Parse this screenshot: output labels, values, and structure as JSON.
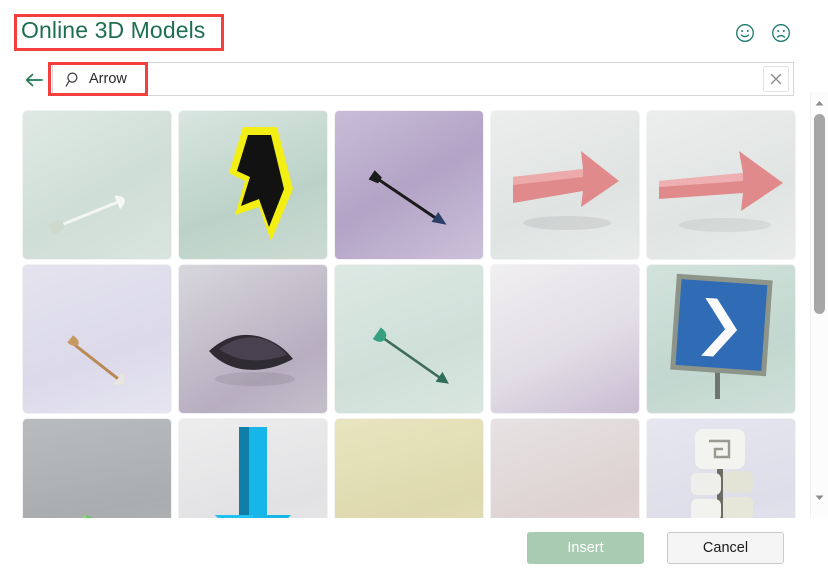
{
  "dialog": {
    "title": "Online 3D Models"
  },
  "header": {
    "feedback": [
      {
        "name": "smiley-face-icon",
        "label": "Send a smile"
      },
      {
        "name": "frowny-face-icon",
        "label": "Send a frown"
      }
    ]
  },
  "search": {
    "back_label": "Back",
    "icon": "search-icon",
    "value": "Arrow",
    "placeholder": "Search",
    "clear_label": "Clear search"
  },
  "scrollbar": {
    "up_label": "Scroll up",
    "down_label": "Scroll down",
    "thumb_label": "Scroll position"
  },
  "footer": {
    "insert_label": "Insert",
    "insert_enabled": false,
    "cancel_label": "Cancel"
  },
  "colors": {
    "title": "#1e6f52",
    "accent_green": "#1e6f52",
    "insert_disabled": "#a8cbb2",
    "annotation": "#f43f3f"
  },
  "results": {
    "count": 15,
    "items": [
      {
        "alt": "white arrow with fletching, pale green background",
        "bg": "linear-gradient(150deg,#dfe9e4 0%,#cfded7 55%,#d9e4de 100%)",
        "model": "arrow-white"
      },
      {
        "alt": "yellow and black 3D bent arrow pointing right",
        "bg": "linear-gradient(160deg,#d7e6e0 0%,#bcd2c8 60%,#cbdbd3 100%)",
        "model": "arrow-yellow-black"
      },
      {
        "alt": "thin black arrow on purple background",
        "bg": "linear-gradient(150deg,#c9bcd8 0%,#b3a3c6 50%,#ccc1da 100%)",
        "model": "arrow-black-thin"
      },
      {
        "alt": "thick pink arrow pointing right",
        "bg": "linear-gradient(160deg,#eceeed 0%,#dfe3e2 60%,#e8ebea 100%)",
        "model": "arrow-pink-thick"
      },
      {
        "alt": "long pink arrow pointing right",
        "bg": "linear-gradient(160deg,#eceeed 0%,#e0e4e3 60%,#e9eceb 100%)",
        "model": "arrow-pink-long"
      },
      {
        "alt": "wooden arrow with white feathers on lavender background",
        "bg": "linear-gradient(160deg,#e4e3ee 0%,#dcdaea 60%,#e6e5f0 100%)",
        "model": "arrow-wood-feather"
      },
      {
        "alt": "dark stone arrowhead on grey purple background",
        "bg": "linear-gradient(150deg,#d8d7dd 0%,#b7aec0 70%,#c6bfcb 100%)",
        "model": "arrowhead-stone"
      },
      {
        "alt": "green arrow on mint background",
        "bg": "linear-gradient(160deg,#dde8e3 0%,#cfe0d9 60%,#dae6e0 100%)",
        "model": "arrow-green-thin"
      },
      {
        "alt": "empty light gradient background",
        "bg": "linear-gradient(155deg,#f0eff0 0%,#e2dee6 55%,#c9bcd2 100%)",
        "model": "arrow-faint"
      },
      {
        "alt": "blue road sign with white chevron arrow",
        "bg": "linear-gradient(160deg,#d2e3dc 0%,#c2d7cf 60%,#cfe0d9 100%)",
        "model": "arrow-road-sign"
      },
      {
        "alt": "green arrow shape on grey background",
        "bg": "linear-gradient(170deg,#b9bcbe 0%,#a9adb0 60%,#b4b8ba 100%)",
        "model": "arrow-green-flat"
      },
      {
        "alt": "cyan 3D arrow pointing down",
        "bg": "linear-gradient(165deg,#ededee 0%,#e2e2e4 60%,#ebebec 100%)",
        "model": "arrow-cyan-down"
      },
      {
        "alt": "small arrow on pale yellow background",
        "bg": "linear-gradient(165deg,#e8e5bf 0%,#ded9ae 60%,#e5e1ba 100%)",
        "model": "arrow-yellow-bg"
      },
      {
        "alt": "small arrow on pale pink background",
        "bg": "linear-gradient(160deg,#e6e2e3 0%,#ded2d2 60%,#e3d9d8 100%)",
        "model": "arrow-pink-bg"
      },
      {
        "alt": "stone totem with arrow carving",
        "bg": "linear-gradient(165deg,#e6e6f0 0%,#dedeea 60%,#e8e8f2 100%)",
        "model": "arrow-stone-totem"
      }
    ]
  }
}
